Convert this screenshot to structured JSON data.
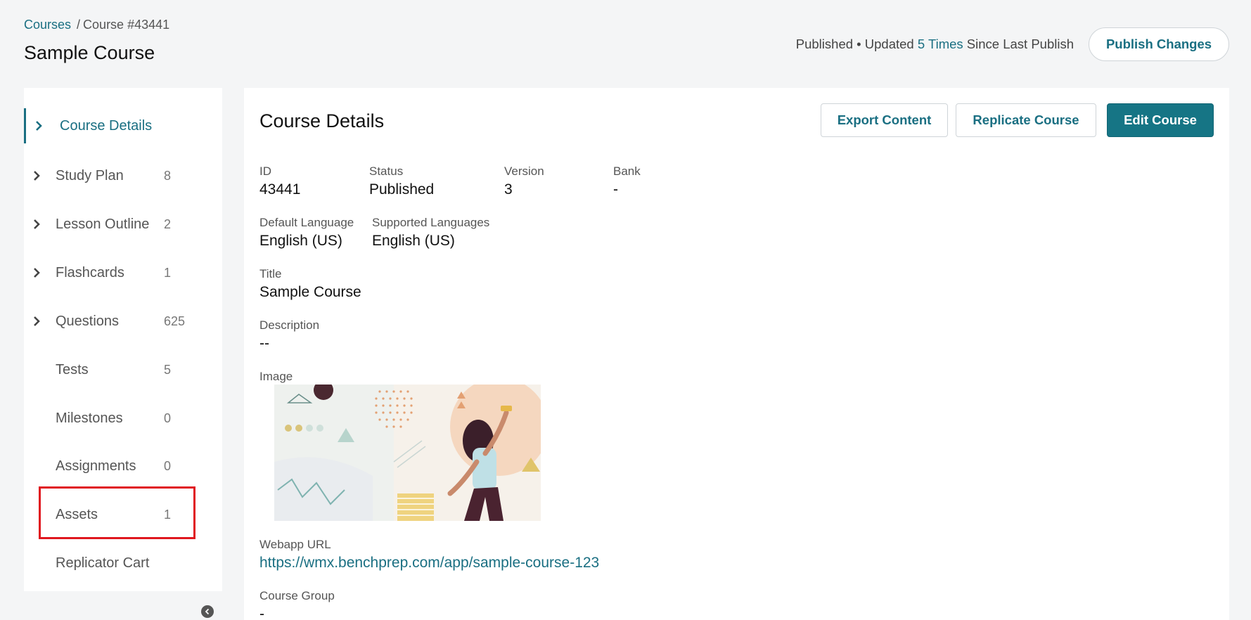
{
  "breadcrumb": {
    "root": "Courses",
    "separator": "/",
    "current": "Course #43441"
  },
  "page_title": "Sample Course",
  "publish": {
    "status_prefix": "Published • Updated",
    "update_count": "5 Times",
    "status_suffix": "Since Last Publish",
    "button_label": "Publish Changes"
  },
  "sidebar": {
    "items": [
      {
        "label": "Course Details",
        "count": "",
        "expandable": true,
        "active": true
      },
      {
        "label": "Study Plan",
        "count": "8",
        "expandable": true
      },
      {
        "label": "Lesson Outline",
        "count": "2",
        "expandable": true
      },
      {
        "label": "Flashcards",
        "count": "1",
        "expandable": true
      },
      {
        "label": "Questions",
        "count": "625",
        "expandable": true
      },
      {
        "label": "Tests",
        "count": "5",
        "expandable": false
      },
      {
        "label": "Milestones",
        "count": "0",
        "expandable": false
      },
      {
        "label": "Assignments",
        "count": "0",
        "expandable": false
      },
      {
        "label": "Assets",
        "count": "1",
        "expandable": false,
        "highlighted": true
      },
      {
        "label": "Replicator Cart",
        "count": "",
        "expandable": false
      }
    ],
    "collapse_icon": "chevron-left-circle-icon"
  },
  "main": {
    "title": "Course Details",
    "buttons": {
      "export": "Export Content",
      "replicate": "Replicate Course",
      "edit": "Edit Course"
    },
    "fields": {
      "id": {
        "label": "ID",
        "value": "43441"
      },
      "status": {
        "label": "Status",
        "value": "Published"
      },
      "version": {
        "label": "Version",
        "value": "3"
      },
      "bank": {
        "label": "Bank",
        "value": "-"
      },
      "default_language": {
        "label": "Default Language",
        "value": "English (US)"
      },
      "supported_languages": {
        "label": "Supported Languages",
        "value": "English (US)"
      },
      "title": {
        "label": "Title",
        "value": "Sample Course"
      },
      "description": {
        "label": "Description",
        "value": "--"
      },
      "image": {
        "label": "Image"
      },
      "webapp_url": {
        "label": "Webapp URL",
        "value": "https://wmx.benchprep.com/app/sample-course-123"
      },
      "course_group": {
        "label": "Course Group",
        "value": "-"
      }
    }
  },
  "colors": {
    "accent": "#1a6f82",
    "primary_button": "#167585",
    "highlight": "#e0171f",
    "page_background": "#f4f5f6"
  }
}
